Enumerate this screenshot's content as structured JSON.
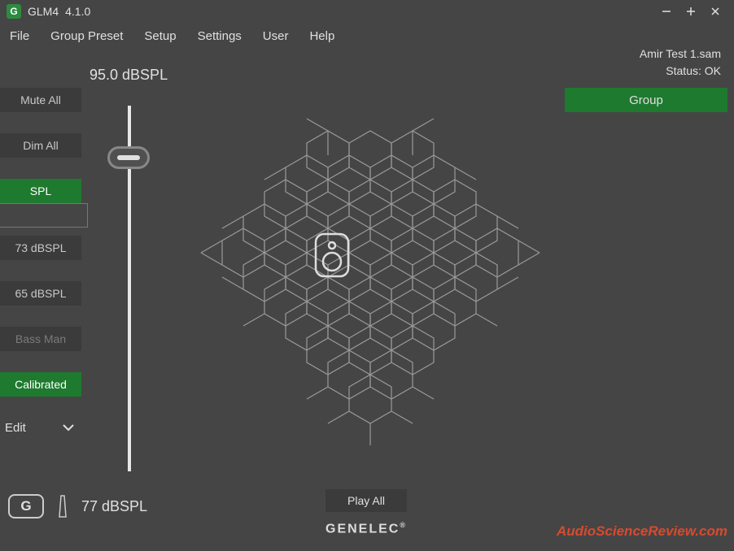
{
  "titlebar": {
    "app_name": "GLM4",
    "version": "4.1.0"
  },
  "menu": {
    "file": "File",
    "group_preset": "Group Preset",
    "setup": "Setup",
    "settings": "Settings",
    "user": "User",
    "help": "Help"
  },
  "status": {
    "filename": "Amir Test 1.sam",
    "status_label": "Status: OK"
  },
  "group_button": "Group",
  "spl_readout": "95.0 dBSPL",
  "sidebar": {
    "mute_all": "Mute All",
    "dim_all": "Dim All",
    "spl": "SPL",
    "preset1": "73 dBSPL",
    "preset2": "65 dBSPL",
    "bass_man": "Bass Man",
    "calibrated": "Calibrated",
    "edit": "Edit"
  },
  "bottom": {
    "g_label": "G",
    "spl_value": "77 dBSPL"
  },
  "play_all": "Play All",
  "brand": "GENELEC",
  "brand_reg": "®",
  "watermark": "AudioScienceReview.com",
  "colors": {
    "accent_green": "#1e7a2e",
    "bg": "#454545",
    "watermark_red": "#d84a2f"
  }
}
